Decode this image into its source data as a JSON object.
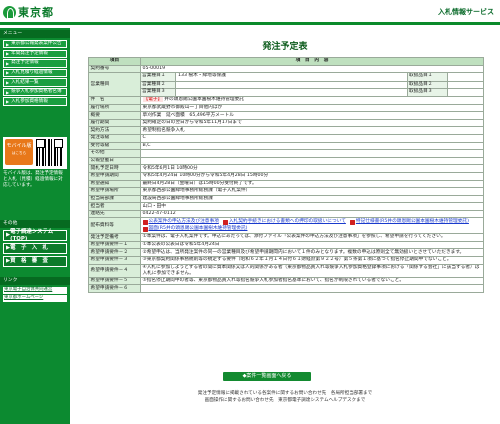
{
  "header": {
    "logo_text": "東京都",
    "service_title": "入札情報サービス"
  },
  "sidebar": {
    "menu_heading": "メニュー",
    "items": [
      {
        "label": "東京都公報発表案件公告"
      },
      {
        "label": "年間発注予定情報"
      },
      {
        "label": "発注予定情報"
      },
      {
        "label": "入札見積り経過情報"
      },
      {
        "label": "入札結果一覧"
      },
      {
        "label": "競争入札参加資格者名簿"
      },
      {
        "label": "入札参加資格情報"
      }
    ],
    "mobile_badge": "モバイル版",
    "mobile_badge_sub": "はこちら",
    "mobile_note": "モバイル版は、発注予定情報と入札（見積）経過情報に対応しています。",
    "other_heading": "その他",
    "big_items": [
      {
        "label": "電子調達システム(TOP)"
      },
      {
        "label": "電　子　入　札"
      },
      {
        "label": "資　格　審　査"
      }
    ],
    "links_heading": "リンク",
    "links": [
      {
        "label": "東京電子自治体共同運営"
      },
      {
        "label": "東京都ホームページ"
      }
    ]
  },
  "main": {
    "heading": "発注予定表",
    "col_item": "項目",
    "col_content": "項　目　内　容",
    "rows": {
      "contract_no_label": "契約番号",
      "contract_no": "05-00019",
      "business_type_label": "営業種目",
      "business_type_rows": [
        {
          "label": "営業種目１",
          "value": "133 樹木・緑地等保護",
          "item_label": "取扱品目１",
          "item_value": ""
        },
        {
          "label": "営業種目２",
          "value": "",
          "item_label": "取扱品目２",
          "item_value": ""
        },
        {
          "label": "営業種目３",
          "value": "",
          "item_label": "取扱品目３",
          "item_value": ""
        }
      ],
      "subject_label": "件　名",
      "subject_badge": "【電子】",
      "subject": "井の頭恩賜公園本園樹木維持管理委託",
      "location_label": "履行場所",
      "location": "東京都武蔵野市御殿山一丁目他内ほか",
      "overview_label": "概要",
      "overview": "草刈作業　延べ面積　65,496平方メートル",
      "period_label": "履行期間",
      "period": "契約確定の日の翌日から令和5年11月17日まで",
      "method_label": "契約方法",
      "method": "希望制指名競争入札",
      "rank_label": "発注等級",
      "rank": "C",
      "accept_rank_label": "受付等級",
      "accept_rank": "B,C",
      "other_label": "その他",
      "other": "",
      "gazette_label": "公報登載日",
      "gazette": "",
      "open_date_label": "開札予定日時",
      "open_date": "令和5年6月1日 10時00分",
      "apply_period_label": "希望申請期間",
      "apply_period": "令和5年4月24日 10時00分から令和5年4月28日 15時00分",
      "nominate_label": "希望通知",
      "nominate": "最終日4月28日（金曜日）は15時00分受付終了です。",
      "apply_place_label": "希望申請場所",
      "apply_place": "東京都西部公園緑地事務所総務課（電子入札案件）",
      "dept_label": "担当局部課",
      "dept": "建設局西部公園緑地事務所総務課",
      "person_label": "担当者",
      "person": "山口・田中",
      "contact_label": "連絡先",
      "contact": "0422-47-0112",
      "docs_label": "配布資料等",
      "docs": [
        {
          "label": "公表案件の申込方法及び注意事項"
        },
        {
          "label": "入札契約手続きにおける書類への押印の取扱いについて"
        },
        {
          "label": "特記仕様書(R5井の頭恩賜公園本園樹木維持管理委託)"
        },
        {
          "label": "図面(R5井の頭恩賜公園本園樹木維持管理委託)"
        }
      ],
      "caution_label": "発注予定備考",
      "caution": "①本案件は、電子入札案件です。申込にあたっては、添付ファイル「公表案件の申込方法及び注意事項」を参照し、希望申請を行ってください。",
      "req1_label": "希望申請要件－１",
      "req1": "①本公表の公表日は令和5年4月24日",
      "req2_label": "希望申請要件－２",
      "req2": "②希望申込は、当所発注案件の同一の営業種目及び希望申請期間内において１件のみとなります。複数の申込は原則全て無効扱いとさせていただきます。",
      "req3_label": "希望申請要件－３",
      "req3": "③東京都契約関係事務規則等の規定する要件（昭和６２年１月１４日付６１財経庶第９２２号）第５条第１項に基づく指名停止期間中でないこと。",
      "req4_label": "希望申請要件－４",
      "req4": "④入札に参加しようとする者の間に資本関係又は人的関係がある者（東京都物品買入れ等競争入札参加資格登録事項における「関係する会社」に該当する者）は入札に参加できません。",
      "req5_label": "希望申請要件－５",
      "req5": "⑤指名停止期間中の者等、東京都物品買入れ等指名競争入札参加者指名基準において、指名が制限されている者でないこと。",
      "req6_label": "希望申請要件－６",
      "req6": ""
    },
    "back_button": "◆案件一覧画面へ戻る",
    "footer_line1": "発注予定情報に掲載されている各案件に関するお問い合わせ先　各局所担当部署まで",
    "footer_line2": "画面操作に関するお問い合わせ先　東京都電子調達システムヘルプデスクまで"
  }
}
